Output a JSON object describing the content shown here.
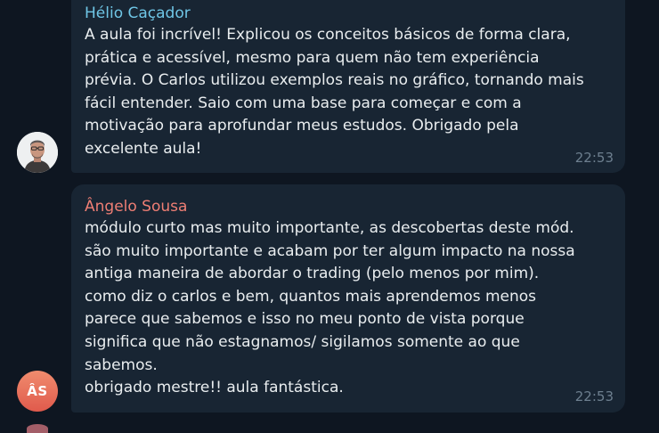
{
  "messages": [
    {
      "sender": "Hélio Caçador",
      "text": "A aula foi incrível! Explicou os conceitos básicos de forma clara,\nprática e acessível, mesmo para quem não tem experiência\nprévia. O Carlos utilizou exemplos reais no gráfico, tornando mais\nfácil entender. Saio com uma base para começar e com a\nmotivação para aprofundar meus estudos. Obrigado pela\nexcelente aula!",
      "time": "22:53",
      "avatar": {
        "type": "photo",
        "icon": "user-photo-icon"
      },
      "name_color": "#6fc6e6"
    },
    {
      "sender": "Ângelo Sousa",
      "text": "módulo curto mas muito importante, as descobertas deste mód.\nsão muito importante e acabam por ter algum impacto na nossa\nantiga maneira de abordar o trading (pelo menos por mim).\ncomo diz o carlos e bem, quantos mais aprendemos menos\nparece que sabemos e isso no meu ponto de vista porque\nsignifica que não estagnamos/ sigilamos somente ao que\nsabemos.\nobrigado mestre!!  aula fantástica.",
      "time": "22:53",
      "avatar": {
        "type": "initials",
        "initials": "ÂS"
      },
      "name_color": "#ee7e74"
    }
  ],
  "colors": {
    "background": "#0e1621",
    "bubble": "#182533",
    "text": "#e9edef",
    "time": "#6d7f8f"
  }
}
